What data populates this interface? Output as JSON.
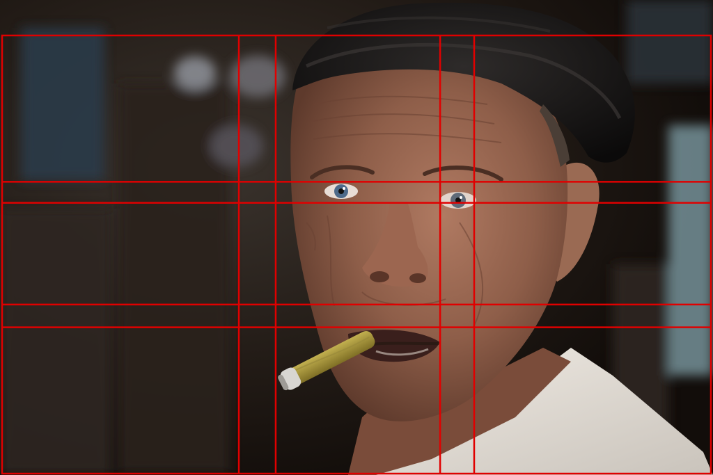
{
  "image": {
    "subject": "portrait",
    "background_color": "#1c1612"
  },
  "overlay": {
    "type": "composition-grid",
    "color": "#e00000",
    "column_divisions": [
      0.334,
      0.386,
      0.618,
      0.666
    ],
    "row_divisions": [
      0.334,
      0.382,
      0.614,
      0.666
    ]
  }
}
